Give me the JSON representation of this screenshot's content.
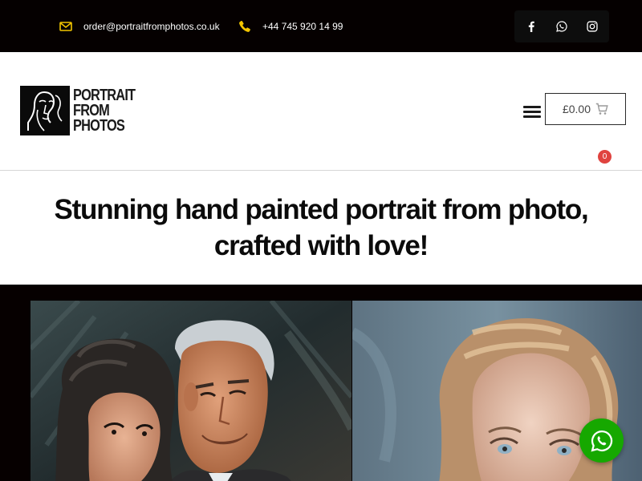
{
  "topbar": {
    "email": "order@portraitfromphotos.co.uk",
    "phone": "+44 745 920 14 99",
    "socials": [
      {
        "icon": "facebook-icon"
      },
      {
        "icon": "whatsapp-icon"
      },
      {
        "icon": "instagram-icon"
      }
    ],
    "accent_color": "#f2c500",
    "background": "#050000"
  },
  "header": {
    "logo_lines": [
      "PORTRAIT",
      "FROM",
      "PHOTOS"
    ],
    "cart": {
      "amount": "£0.00",
      "count": "0",
      "badge_color": "#e0433f"
    }
  },
  "hero": {
    "title": "Stunning hand painted portrait from photo, crafted with love!"
  },
  "gallery": {
    "paintings": [
      {
        "subject": "couple-portrait-painting"
      },
      {
        "subject": "woman-portrait-painting"
      }
    ]
  },
  "whatsapp_float": {
    "icon": "whatsapp-icon",
    "color": "#16a800"
  }
}
